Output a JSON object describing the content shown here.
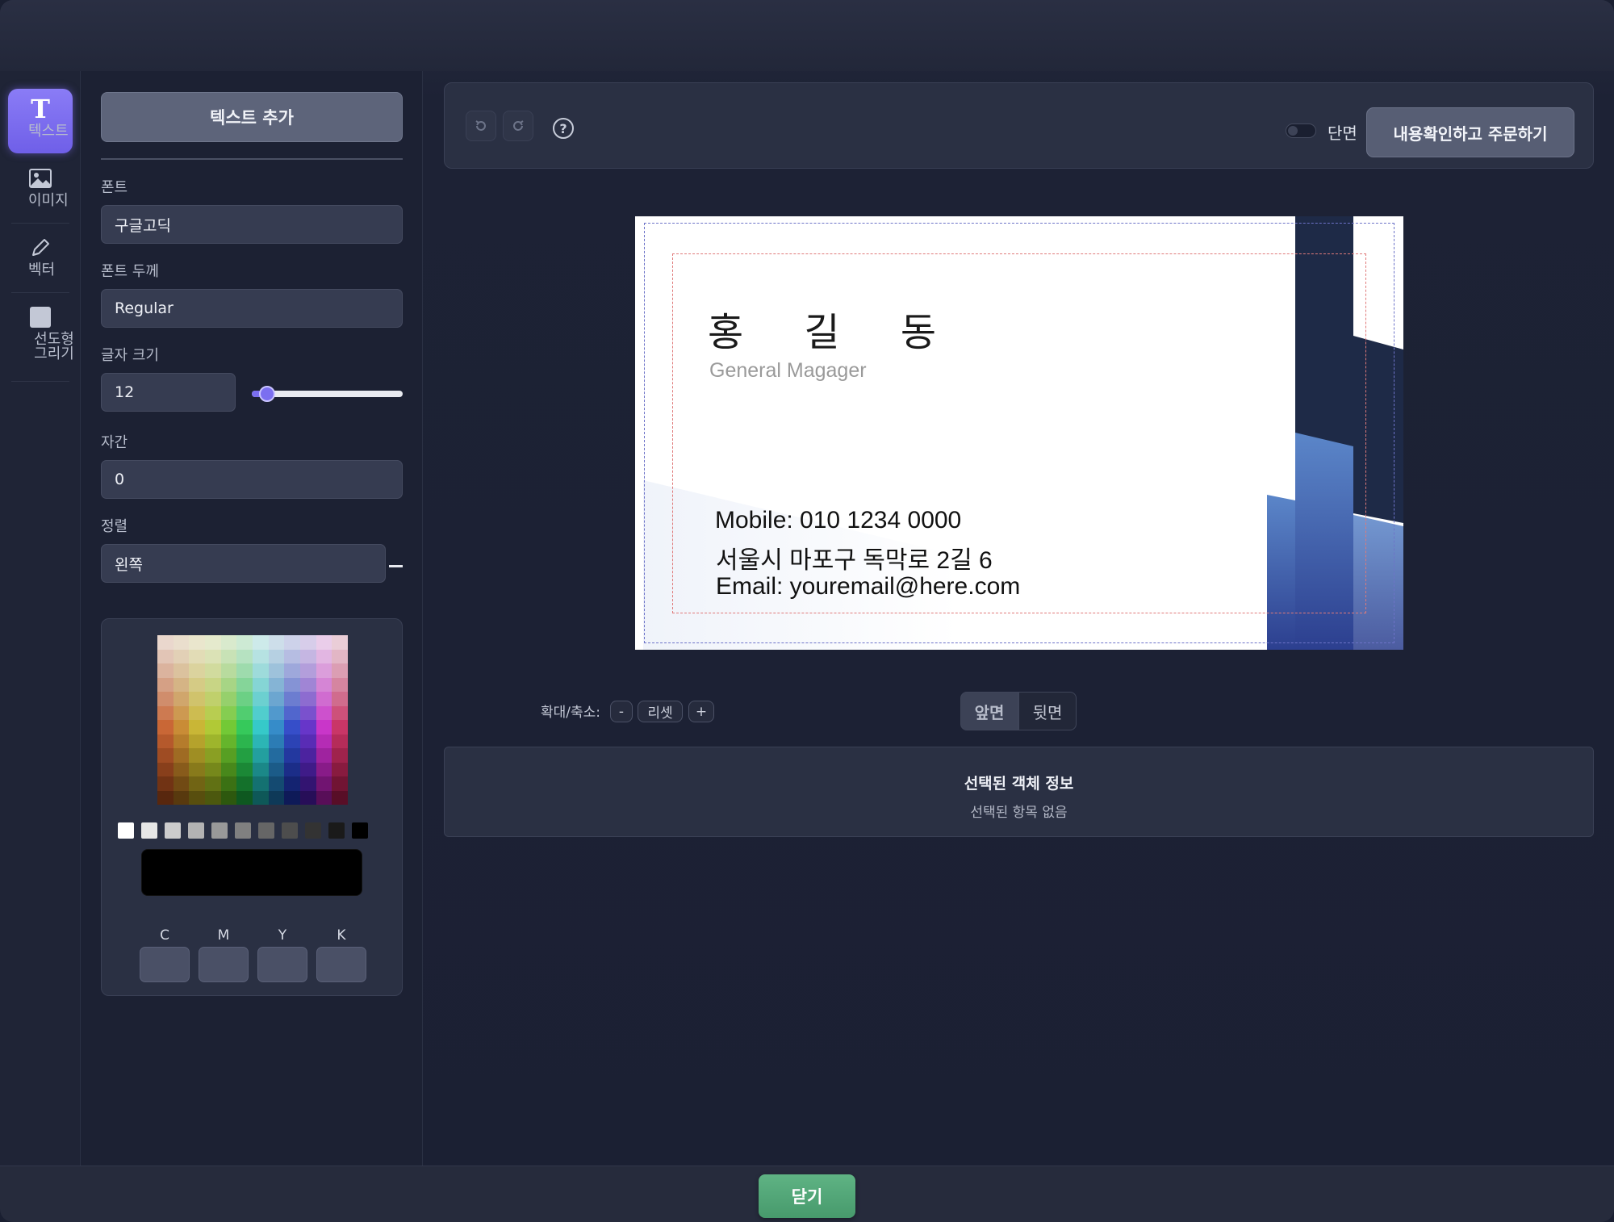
{
  "rail": {
    "items": [
      {
        "label": "텍스트",
        "icon": "text-icon",
        "active": true
      },
      {
        "label": "이미지",
        "icon": "image-icon",
        "active": false
      },
      {
        "label": "벡터",
        "icon": "pencil-icon",
        "active": false
      },
      {
        "label": "선도형그리기",
        "icon": "shape-icon",
        "active": false
      }
    ]
  },
  "panel": {
    "add_text_label": "텍스트 추가",
    "font_label": "폰트",
    "font_value": "구글고딕",
    "weight_label": "폰트 두께",
    "weight_value": "Regular",
    "size_label": "글자 크기",
    "size_value": "12",
    "size_slider_fraction": 0.1,
    "spacing_label": "자간",
    "spacing_value": "0",
    "align_label": "정렬",
    "align_value": "왼쪽",
    "current_color": "#000000",
    "cmyk_labels": [
      "C",
      "M",
      "Y",
      "K"
    ]
  },
  "toolbar": {
    "undo_icon": "undo-icon",
    "redo_icon": "redo-icon",
    "help_glyph": "?",
    "single_side_label": "단면",
    "order_label": "내용확인하고 주문하기"
  },
  "card": {
    "name": "홍 길 동",
    "title": "General Magager",
    "mobile": "Mobile: 010 1234 0000",
    "address": "서울시 마포구 독막로 2길 6",
    "email": "Email: youremail@here.com",
    "accent_colors": [
      "#1e2a47",
      "#5b86c9",
      "#2c3f8f"
    ]
  },
  "zoom": {
    "label": "확대/축소:",
    "minus": "-",
    "reset": "리셋",
    "plus": "+"
  },
  "sides": {
    "front": "앞면",
    "back": "뒷면"
  },
  "info": {
    "title": "선택된 객체 정보",
    "empty": "선택된 항목 없음"
  },
  "footer": {
    "close_label": "닫기",
    "close_color": "#55a97a"
  }
}
